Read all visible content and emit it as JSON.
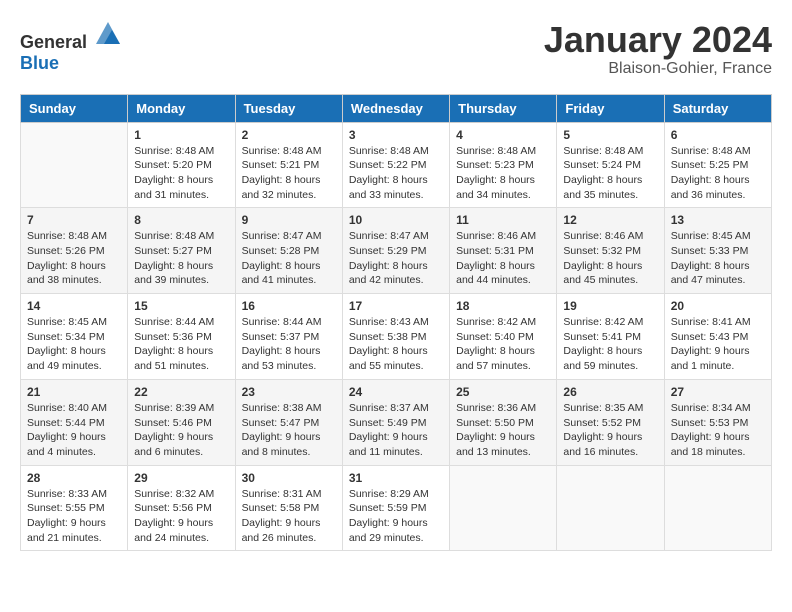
{
  "header": {
    "logo_general": "General",
    "logo_blue": "Blue",
    "month_title": "January 2024",
    "location": "Blaison-Gohier, France"
  },
  "weekdays": [
    "Sunday",
    "Monday",
    "Tuesday",
    "Wednesday",
    "Thursday",
    "Friday",
    "Saturday"
  ],
  "weeks": [
    [
      {
        "day": "",
        "sunrise": "",
        "sunset": "",
        "daylight": ""
      },
      {
        "day": "1",
        "sunrise": "Sunrise: 8:48 AM",
        "sunset": "Sunset: 5:20 PM",
        "daylight": "Daylight: 8 hours and 31 minutes."
      },
      {
        "day": "2",
        "sunrise": "Sunrise: 8:48 AM",
        "sunset": "Sunset: 5:21 PM",
        "daylight": "Daylight: 8 hours and 32 minutes."
      },
      {
        "day": "3",
        "sunrise": "Sunrise: 8:48 AM",
        "sunset": "Sunset: 5:22 PM",
        "daylight": "Daylight: 8 hours and 33 minutes."
      },
      {
        "day": "4",
        "sunrise": "Sunrise: 8:48 AM",
        "sunset": "Sunset: 5:23 PM",
        "daylight": "Daylight: 8 hours and 34 minutes."
      },
      {
        "day": "5",
        "sunrise": "Sunrise: 8:48 AM",
        "sunset": "Sunset: 5:24 PM",
        "daylight": "Daylight: 8 hours and 35 minutes."
      },
      {
        "day": "6",
        "sunrise": "Sunrise: 8:48 AM",
        "sunset": "Sunset: 5:25 PM",
        "daylight": "Daylight: 8 hours and 36 minutes."
      }
    ],
    [
      {
        "day": "7",
        "sunrise": "Sunrise: 8:48 AM",
        "sunset": "Sunset: 5:26 PM",
        "daylight": "Daylight: 8 hours and 38 minutes."
      },
      {
        "day": "8",
        "sunrise": "Sunrise: 8:48 AM",
        "sunset": "Sunset: 5:27 PM",
        "daylight": "Daylight: 8 hours and 39 minutes."
      },
      {
        "day": "9",
        "sunrise": "Sunrise: 8:47 AM",
        "sunset": "Sunset: 5:28 PM",
        "daylight": "Daylight: 8 hours and 41 minutes."
      },
      {
        "day": "10",
        "sunrise": "Sunrise: 8:47 AM",
        "sunset": "Sunset: 5:29 PM",
        "daylight": "Daylight: 8 hours and 42 minutes."
      },
      {
        "day": "11",
        "sunrise": "Sunrise: 8:46 AM",
        "sunset": "Sunset: 5:31 PM",
        "daylight": "Daylight: 8 hours and 44 minutes."
      },
      {
        "day": "12",
        "sunrise": "Sunrise: 8:46 AM",
        "sunset": "Sunset: 5:32 PM",
        "daylight": "Daylight: 8 hours and 45 minutes."
      },
      {
        "day": "13",
        "sunrise": "Sunrise: 8:45 AM",
        "sunset": "Sunset: 5:33 PM",
        "daylight": "Daylight: 8 hours and 47 minutes."
      }
    ],
    [
      {
        "day": "14",
        "sunrise": "Sunrise: 8:45 AM",
        "sunset": "Sunset: 5:34 PM",
        "daylight": "Daylight: 8 hours and 49 minutes."
      },
      {
        "day": "15",
        "sunrise": "Sunrise: 8:44 AM",
        "sunset": "Sunset: 5:36 PM",
        "daylight": "Daylight: 8 hours and 51 minutes."
      },
      {
        "day": "16",
        "sunrise": "Sunrise: 8:44 AM",
        "sunset": "Sunset: 5:37 PM",
        "daylight": "Daylight: 8 hours and 53 minutes."
      },
      {
        "day": "17",
        "sunrise": "Sunrise: 8:43 AM",
        "sunset": "Sunset: 5:38 PM",
        "daylight": "Daylight: 8 hours and 55 minutes."
      },
      {
        "day": "18",
        "sunrise": "Sunrise: 8:42 AM",
        "sunset": "Sunset: 5:40 PM",
        "daylight": "Daylight: 8 hours and 57 minutes."
      },
      {
        "day": "19",
        "sunrise": "Sunrise: 8:42 AM",
        "sunset": "Sunset: 5:41 PM",
        "daylight": "Daylight: 8 hours and 59 minutes."
      },
      {
        "day": "20",
        "sunrise": "Sunrise: 8:41 AM",
        "sunset": "Sunset: 5:43 PM",
        "daylight": "Daylight: 9 hours and 1 minute."
      }
    ],
    [
      {
        "day": "21",
        "sunrise": "Sunrise: 8:40 AM",
        "sunset": "Sunset: 5:44 PM",
        "daylight": "Daylight: 9 hours and 4 minutes."
      },
      {
        "day": "22",
        "sunrise": "Sunrise: 8:39 AM",
        "sunset": "Sunset: 5:46 PM",
        "daylight": "Daylight: 9 hours and 6 minutes."
      },
      {
        "day": "23",
        "sunrise": "Sunrise: 8:38 AM",
        "sunset": "Sunset: 5:47 PM",
        "daylight": "Daylight: 9 hours and 8 minutes."
      },
      {
        "day": "24",
        "sunrise": "Sunrise: 8:37 AM",
        "sunset": "Sunset: 5:49 PM",
        "daylight": "Daylight: 9 hours and 11 minutes."
      },
      {
        "day": "25",
        "sunrise": "Sunrise: 8:36 AM",
        "sunset": "Sunset: 5:50 PM",
        "daylight": "Daylight: 9 hours and 13 minutes."
      },
      {
        "day": "26",
        "sunrise": "Sunrise: 8:35 AM",
        "sunset": "Sunset: 5:52 PM",
        "daylight": "Daylight: 9 hours and 16 minutes."
      },
      {
        "day": "27",
        "sunrise": "Sunrise: 8:34 AM",
        "sunset": "Sunset: 5:53 PM",
        "daylight": "Daylight: 9 hours and 18 minutes."
      }
    ],
    [
      {
        "day": "28",
        "sunrise": "Sunrise: 8:33 AM",
        "sunset": "Sunset: 5:55 PM",
        "daylight": "Daylight: 9 hours and 21 minutes."
      },
      {
        "day": "29",
        "sunrise": "Sunrise: 8:32 AM",
        "sunset": "Sunset: 5:56 PM",
        "daylight": "Daylight: 9 hours and 24 minutes."
      },
      {
        "day": "30",
        "sunrise": "Sunrise: 8:31 AM",
        "sunset": "Sunset: 5:58 PM",
        "daylight": "Daylight: 9 hours and 26 minutes."
      },
      {
        "day": "31",
        "sunrise": "Sunrise: 8:29 AM",
        "sunset": "Sunset: 5:59 PM",
        "daylight": "Daylight: 9 hours and 29 minutes."
      },
      {
        "day": "",
        "sunrise": "",
        "sunset": "",
        "daylight": ""
      },
      {
        "day": "",
        "sunrise": "",
        "sunset": "",
        "daylight": ""
      },
      {
        "day": "",
        "sunrise": "",
        "sunset": "",
        "daylight": ""
      }
    ]
  ]
}
